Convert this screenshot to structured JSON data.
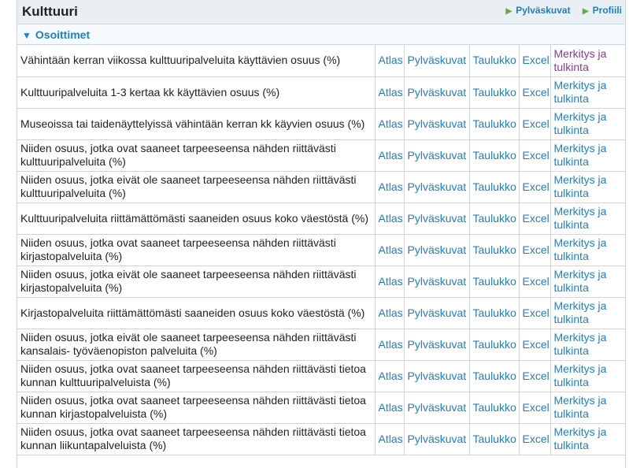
{
  "header": {
    "title": "Kulttuuri",
    "links": [
      {
        "label": "Pylväskuvat"
      },
      {
        "label": "Profiili"
      }
    ]
  },
  "section": {
    "title": "Osoittimet"
  },
  "link_labels": {
    "atlas": "Atlas",
    "pylvaskuvat": "Pylväskuvat",
    "taulukko": "Taulukko",
    "excel": "Excel",
    "merkitys": "Merkitys ja tulkinta"
  },
  "rows": [
    {
      "name": "Vähintään kerran viikossa kulttuuripalveluita käyttävien osuus (%)"
    },
    {
      "name": "Kulttuuripalveluita 1-3 kertaa kk käyttävien osuus (%)"
    },
    {
      "name": "Museoissa tai taidenäyttelyissä vähintään kerran kk käyvien osuus (%)"
    },
    {
      "name": "Niiden osuus, jotka ovat saaneet tarpeeseensa nähden riittävästi kulttuuripalveluita (%)"
    },
    {
      "name": "Niiden osuus, jotka eivät ole saaneet tarpeeseensa nähden riittävästi kulttuuripalveluita (%)"
    },
    {
      "name": "Kulttuuripalveluita riittämättömästi saaneiden osuus koko väestöstä (%)"
    },
    {
      "name": "Niiden osuus, jotka ovat saaneet tarpeeseensa nähden riittävästi kirjastopalveluita (%)"
    },
    {
      "name": "Niiden osuus, jotka eivät ole saaneet tarpeeseensa nähden riittävästi kirjastopalveluita (%)"
    },
    {
      "name": "Kirjastopalveluita riittämättömästi saaneiden osuus koko väestöstä (%)"
    },
    {
      "name": "Niiden osuus, jotka eivät ole saaneet tarpeeseensa nähden riittävästi kansalais- työväenopiston palveluita (%)"
    },
    {
      "name": "Niiden osuus, jotka ovat saaneet tarpeeseensa nähden riittävästi tietoa kunnan kulttuuripalveluista (%)"
    },
    {
      "name": "Niiden osuus, jotka ovat saaneet tarpeeseensa nähden riittävästi tietoa kunnan kirjastopalveluista (%)"
    },
    {
      "name": "Niiden osuus, jotka ovat saaneet tarpeeseensa nähden riittävästi tietoa kunnan liikuntapalveluista (%)"
    }
  ]
}
